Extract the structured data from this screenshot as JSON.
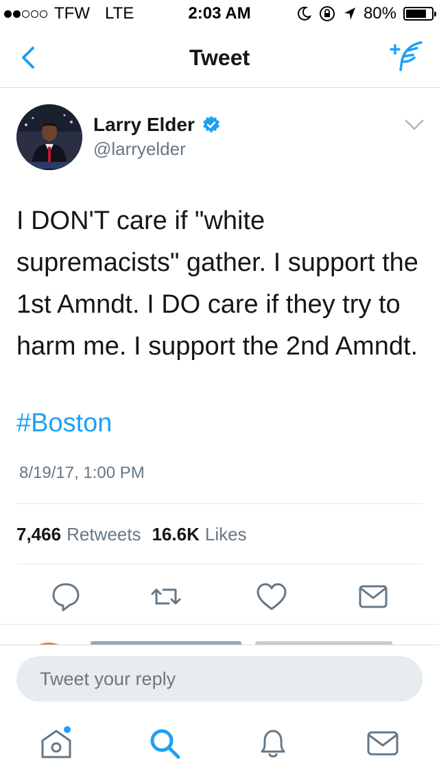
{
  "status_bar": {
    "carrier": "TFW",
    "network": "LTE",
    "time": "2:03 AM",
    "battery": "80%",
    "battery_level": 0.8
  },
  "nav": {
    "title": "Tweet",
    "back_icon": "chevron-left-icon",
    "compose_icon": "compose-tweet-icon"
  },
  "tweet": {
    "author_name": "Larry Elder",
    "author_handle": "@larryelder",
    "verified": true,
    "text": "I DON'T care if \"white supremacists\" gather. I support the 1st Amndt. I DO care if they try to harm me. I support the 2nd Amndt.",
    "hashtag": "#Boston",
    "timestamp": "8/19/17, 1:00 PM",
    "retweets_count": "7,466",
    "retweets_label": "Retweets",
    "likes_count": "16.6K",
    "likes_label": "Likes"
  },
  "actions": [
    "reply-icon",
    "retweet-icon",
    "like-icon",
    "direct-message-icon"
  ],
  "reply": {
    "placeholder": "Tweet your reply"
  },
  "tabbar": [
    "home-icon",
    "search-icon",
    "notifications-icon",
    "messages-icon"
  ],
  "colors": {
    "accent": "#1da1f2",
    "text": "#14171a",
    "secondary": "#657786",
    "divider": "#e1e8ed"
  }
}
